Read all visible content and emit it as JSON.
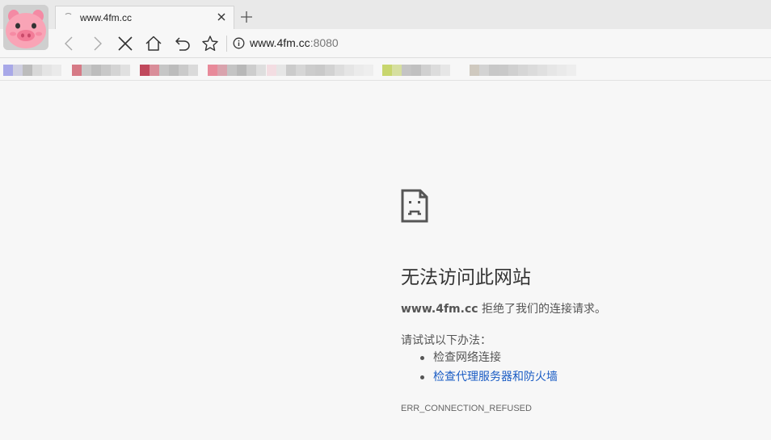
{
  "tab": {
    "title": "www.4fm.cc",
    "close_icon": "close-icon",
    "loading_icon": "spinner-icon"
  },
  "toolbar": {
    "back_icon": "back-arrow-icon",
    "forward_icon": "forward-arrow-icon",
    "stop_icon": "stop-icon",
    "home_icon": "home-icon",
    "undo_icon": "undo-icon",
    "bookmark_icon": "star-icon",
    "url_host": "www.4fm.cc",
    "url_port": ":8080"
  },
  "error_page": {
    "icon": "sad-page-icon",
    "title": "无法访问此网站",
    "site": "www.4fm.cc",
    "description": " 拒绝了我们的连接请求。",
    "try_label": "请试试以下办法：",
    "suggestions": [
      "检查网络连接",
      "检查代理服务器和防火墙"
    ],
    "error_code": "ERR_CONNECTION_REFUSED"
  },
  "colors": {
    "link": "#1a5cc4",
    "text": "#555555",
    "title": "#333333",
    "background": "#f7f7f7"
  }
}
